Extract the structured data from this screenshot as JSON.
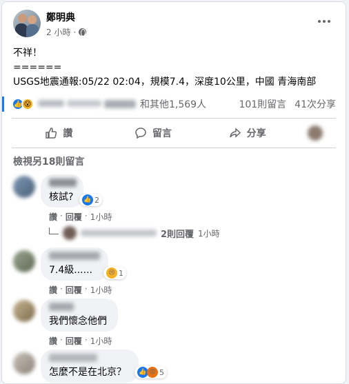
{
  "post": {
    "author": "鄭明典",
    "time": "2 小時",
    "lines": [
      "不祥！",
      "======",
      "USGS地震通報:05/22 02:04，規模7.4，深度10公里，中國 青海南部"
    ]
  },
  "reactions": {
    "others_text": "和其他1,569人",
    "comments_count": "101則留言",
    "shares_count": "41次分享"
  },
  "actions": {
    "like_label": "讚",
    "comment_label": "留言",
    "share_label": "分享"
  },
  "view_more": "檢視另18則留言",
  "comments": [
    {
      "text": "核試?",
      "reaction_count": "2",
      "reaction": "like",
      "like_label": "讚",
      "reply_label": "回覆",
      "time": "1小時"
    },
    {
      "text": "7.4級......",
      "reaction_count": "1",
      "reaction": "sad",
      "like_label": "讚",
      "reply_label": "回覆",
      "time": "1小時"
    },
    {
      "text": "我們懷念他們",
      "like_label": "讚",
      "reply_label": "回覆",
      "time": "1小時"
    },
    {
      "text": "怎麼不是在北京？",
      "reaction_count": "5",
      "reaction": "like-angry"
    }
  ],
  "replies": {
    "label": "2則回覆",
    "time": "1小時"
  },
  "icons": {
    "like": "thumbs-up-icon",
    "comment": "speech-bubble-icon",
    "share": "share-arrow-icon",
    "privacy": "globe-icon",
    "menu": "more-dots-icon"
  },
  "colors": {
    "accent": "#1877f2",
    "secondary_text": "#65676b",
    "bubble": "#f0f2f5"
  }
}
